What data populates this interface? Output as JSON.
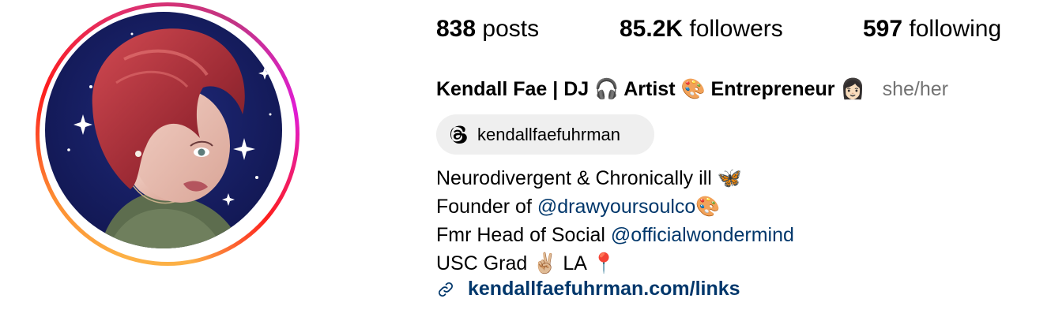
{
  "profile": {
    "avatar_alt": "profile-photo",
    "stats": {
      "posts_count": "838",
      "posts_label": "posts",
      "followers_count": "85.2K",
      "followers_label": "followers",
      "following_count": "597",
      "following_label": "following"
    },
    "display_name": "Kendall Fae | DJ 🎧 Artist 🎨 Entrepreneur 👩🏻",
    "pronouns": "she/her",
    "threads": {
      "icon": "threads-icon",
      "handle": "kendallfaefuhrman"
    },
    "bio": {
      "line1_text": "Neurodivergent & Chronically ill",
      "line1_emoji": "🦋",
      "line2_prefix": "Founder of ",
      "line2_mention": "@drawyoursoulco",
      "line2_emoji": "🎨",
      "line3_prefix": "Fmr Head of Social ",
      "line3_mention": "@officialwondermind",
      "line4_text": "USC Grad ✌🏼 LA",
      "line4_emoji": "📍"
    },
    "link": {
      "icon": "link-icon",
      "text": "kendallfaefuhrman.com/links"
    }
  },
  "colors": {
    "mention": "#00376b",
    "pronouns": "#737373",
    "pill_bg": "#efefef",
    "avatar_bg": "#141a5c"
  }
}
